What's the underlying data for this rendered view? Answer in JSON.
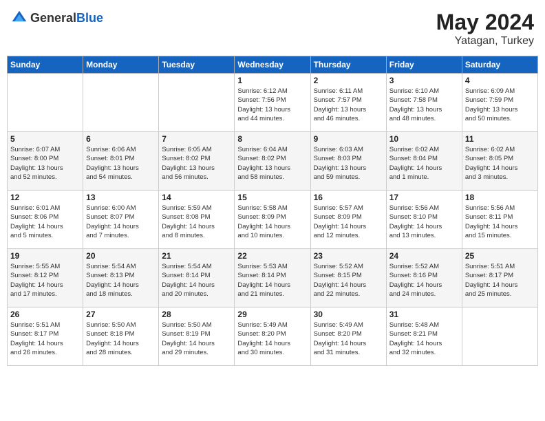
{
  "header": {
    "logo_general": "General",
    "logo_blue": "Blue",
    "month_year": "May 2024",
    "location": "Yatagan, Turkey"
  },
  "days_of_week": [
    "Sunday",
    "Monday",
    "Tuesday",
    "Wednesday",
    "Thursday",
    "Friday",
    "Saturday"
  ],
  "weeks": [
    [
      {
        "day": "",
        "info": ""
      },
      {
        "day": "",
        "info": ""
      },
      {
        "day": "",
        "info": ""
      },
      {
        "day": "1",
        "info": "Sunrise: 6:12 AM\nSunset: 7:56 PM\nDaylight: 13 hours\nand 44 minutes."
      },
      {
        "day": "2",
        "info": "Sunrise: 6:11 AM\nSunset: 7:57 PM\nDaylight: 13 hours\nand 46 minutes."
      },
      {
        "day": "3",
        "info": "Sunrise: 6:10 AM\nSunset: 7:58 PM\nDaylight: 13 hours\nand 48 minutes."
      },
      {
        "day": "4",
        "info": "Sunrise: 6:09 AM\nSunset: 7:59 PM\nDaylight: 13 hours\nand 50 minutes."
      }
    ],
    [
      {
        "day": "5",
        "info": "Sunrise: 6:07 AM\nSunset: 8:00 PM\nDaylight: 13 hours\nand 52 minutes."
      },
      {
        "day": "6",
        "info": "Sunrise: 6:06 AM\nSunset: 8:01 PM\nDaylight: 13 hours\nand 54 minutes."
      },
      {
        "day": "7",
        "info": "Sunrise: 6:05 AM\nSunset: 8:02 PM\nDaylight: 13 hours\nand 56 minutes."
      },
      {
        "day": "8",
        "info": "Sunrise: 6:04 AM\nSunset: 8:02 PM\nDaylight: 13 hours\nand 58 minutes."
      },
      {
        "day": "9",
        "info": "Sunrise: 6:03 AM\nSunset: 8:03 PM\nDaylight: 13 hours\nand 59 minutes."
      },
      {
        "day": "10",
        "info": "Sunrise: 6:02 AM\nSunset: 8:04 PM\nDaylight: 14 hours\nand 1 minute."
      },
      {
        "day": "11",
        "info": "Sunrise: 6:02 AM\nSunset: 8:05 PM\nDaylight: 14 hours\nand 3 minutes."
      }
    ],
    [
      {
        "day": "12",
        "info": "Sunrise: 6:01 AM\nSunset: 8:06 PM\nDaylight: 14 hours\nand 5 minutes."
      },
      {
        "day": "13",
        "info": "Sunrise: 6:00 AM\nSunset: 8:07 PM\nDaylight: 14 hours\nand 7 minutes."
      },
      {
        "day": "14",
        "info": "Sunrise: 5:59 AM\nSunset: 8:08 PM\nDaylight: 14 hours\nand 8 minutes."
      },
      {
        "day": "15",
        "info": "Sunrise: 5:58 AM\nSunset: 8:09 PM\nDaylight: 14 hours\nand 10 minutes."
      },
      {
        "day": "16",
        "info": "Sunrise: 5:57 AM\nSunset: 8:09 PM\nDaylight: 14 hours\nand 12 minutes."
      },
      {
        "day": "17",
        "info": "Sunrise: 5:56 AM\nSunset: 8:10 PM\nDaylight: 14 hours\nand 13 minutes."
      },
      {
        "day": "18",
        "info": "Sunrise: 5:56 AM\nSunset: 8:11 PM\nDaylight: 14 hours\nand 15 minutes."
      }
    ],
    [
      {
        "day": "19",
        "info": "Sunrise: 5:55 AM\nSunset: 8:12 PM\nDaylight: 14 hours\nand 17 minutes."
      },
      {
        "day": "20",
        "info": "Sunrise: 5:54 AM\nSunset: 8:13 PM\nDaylight: 14 hours\nand 18 minutes."
      },
      {
        "day": "21",
        "info": "Sunrise: 5:54 AM\nSunset: 8:14 PM\nDaylight: 14 hours\nand 20 minutes."
      },
      {
        "day": "22",
        "info": "Sunrise: 5:53 AM\nSunset: 8:14 PM\nDaylight: 14 hours\nand 21 minutes."
      },
      {
        "day": "23",
        "info": "Sunrise: 5:52 AM\nSunset: 8:15 PM\nDaylight: 14 hours\nand 22 minutes."
      },
      {
        "day": "24",
        "info": "Sunrise: 5:52 AM\nSunset: 8:16 PM\nDaylight: 14 hours\nand 24 minutes."
      },
      {
        "day": "25",
        "info": "Sunrise: 5:51 AM\nSunset: 8:17 PM\nDaylight: 14 hours\nand 25 minutes."
      }
    ],
    [
      {
        "day": "26",
        "info": "Sunrise: 5:51 AM\nSunset: 8:17 PM\nDaylight: 14 hours\nand 26 minutes."
      },
      {
        "day": "27",
        "info": "Sunrise: 5:50 AM\nSunset: 8:18 PM\nDaylight: 14 hours\nand 28 minutes."
      },
      {
        "day": "28",
        "info": "Sunrise: 5:50 AM\nSunset: 8:19 PM\nDaylight: 14 hours\nand 29 minutes."
      },
      {
        "day": "29",
        "info": "Sunrise: 5:49 AM\nSunset: 8:20 PM\nDaylight: 14 hours\nand 30 minutes."
      },
      {
        "day": "30",
        "info": "Sunrise: 5:49 AM\nSunset: 8:20 PM\nDaylight: 14 hours\nand 31 minutes."
      },
      {
        "day": "31",
        "info": "Sunrise: 5:48 AM\nSunset: 8:21 PM\nDaylight: 14 hours\nand 32 minutes."
      },
      {
        "day": "",
        "info": ""
      }
    ]
  ]
}
